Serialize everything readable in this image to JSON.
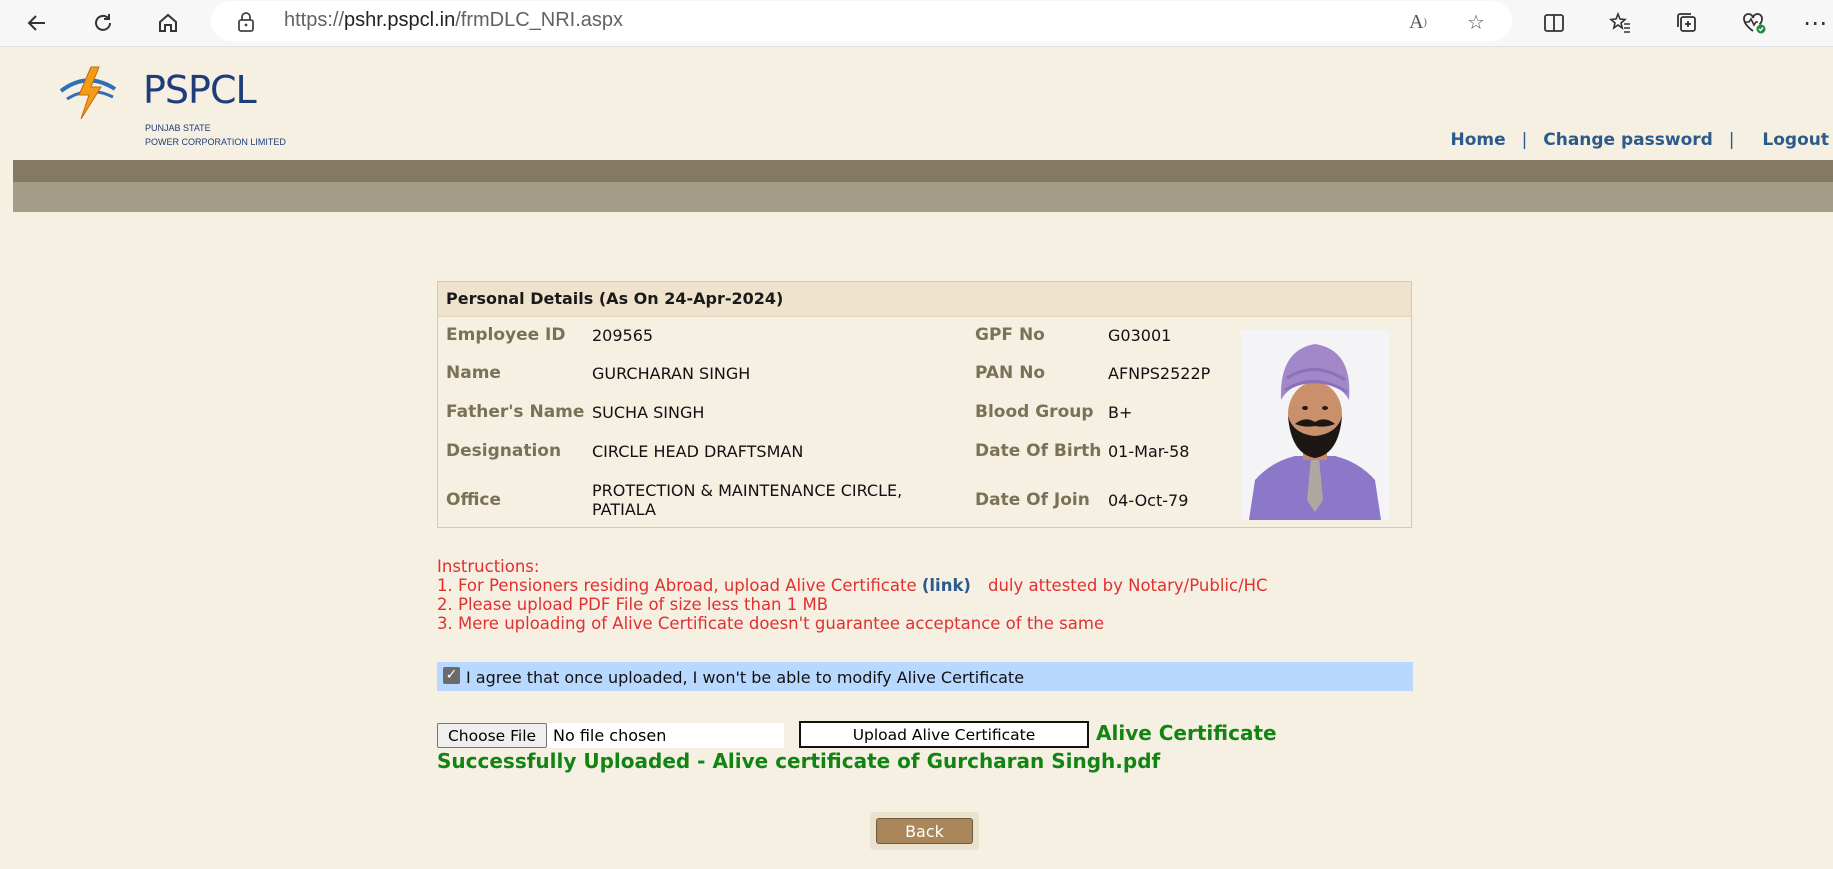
{
  "browser": {
    "url_prefix": "https://",
    "url_host": "pshr.pspcl.in",
    "url_path": "/frmDLC_NRI.aspx"
  },
  "logo": {
    "brand": "PSPCL",
    "line1": "PUNJAB STATE",
    "line2": "POWER CORPORATION LIMITED"
  },
  "nav": {
    "home": "Home",
    "separator": "|",
    "change_password": "Change password",
    "logout": "Logout"
  },
  "details": {
    "title": "Personal Details (As On 24-Apr-2024)",
    "labels": {
      "employee_id": "Employee ID",
      "name": "Name",
      "fathers_name": "Father's Name",
      "designation": "Designation",
      "office": "Office",
      "gpf_no": "GPF No",
      "pan_no": "PAN No",
      "blood_group": "Blood Group",
      "dob": "Date Of Birth",
      "doj": "Date Of Join"
    },
    "values": {
      "employee_id": "209565",
      "name": "GURCHARAN SINGH",
      "fathers_name": "SUCHA SINGH",
      "designation": "CIRCLE HEAD DRAFTSMAN",
      "office_line1": "PROTECTION & MAINTENANCE CIRCLE,",
      "office_line2": "PATIALA",
      "gpf_no": "G03001",
      "pan_no": "AFNPS2522P",
      "blood_group": "B+",
      "dob": "01-Mar-58",
      "doj": "04-Oct-79"
    }
  },
  "instructions": {
    "heading": "Instructions:",
    "line1_a": "1. For Pensioners residing Abroad, upload Alive Certificate ",
    "line1_link": "(link)",
    "line1_b": "duly attested by Notary/Public/HC",
    "line2": "2. Please upload PDF File of size less than 1 MB",
    "line3": "3. Mere uploading of Alive Certificate doesn't guarantee acceptance of the same"
  },
  "agree": {
    "checked": true,
    "text": "I agree that once uploaded, I won't be able to modify Alive Certificate"
  },
  "upload": {
    "choose_label": "Choose File",
    "file_status": "No file chosen",
    "upload_label": "Upload Alive Certificate",
    "success": "Alive Certificate Successfully Uploaded - Alive certificate of Gurcharan Singh.pdf"
  },
  "back_label": "Back"
}
